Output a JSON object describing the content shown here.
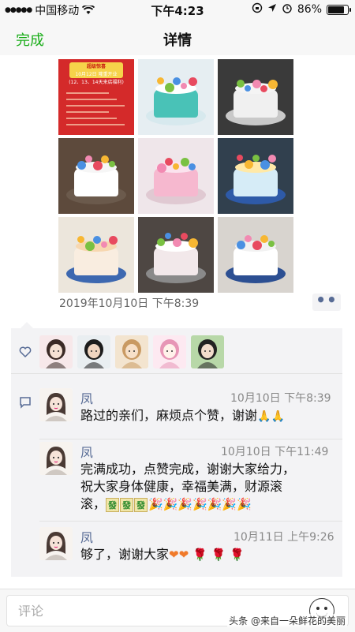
{
  "status_bar": {
    "carrier": "中国移动",
    "time": "下午4:23",
    "battery": "86%",
    "battery_level": 0.86
  },
  "nav": {
    "done_label": "完成",
    "title": "详情"
  },
  "photos": [
    {
      "name": "photo-poster",
      "kind": "poster",
      "poster_lines": [
        "超级惊喜",
        "10月12日 隆重开业",
        "(12、13、14天来店福利)"
      ]
    },
    {
      "name": "photo-cake-teal",
      "kind": "cake",
      "top": "#ffffff",
      "body": "#49c2b7",
      "plate": "#d7e9ee",
      "bg": "#e6eef2"
    },
    {
      "name": "photo-cake-stars",
      "kind": "cake",
      "top": "#f4f4f4",
      "body": "#f0f0f0",
      "plate": "#c9c9c9",
      "bg": "#3a3a3a"
    },
    {
      "name": "photo-cake-dolls",
      "kind": "cake",
      "top": "#f6f6f6",
      "body": "#ffffff",
      "plate": "#6b5a4c",
      "bg": "#5d4a3c"
    },
    {
      "name": "photo-cake-pink",
      "kind": "cake",
      "top": "#fbe3ee",
      "body": "#f6b8cf",
      "plate": "#e0c9d2",
      "bg": "#efe6ea"
    },
    {
      "name": "photo-cake-train",
      "kind": "cake",
      "top": "#ffe9a8",
      "body": "#d6ecf7",
      "plate": "#2e5aa8",
      "bg": "#31404e"
    },
    {
      "name": "photo-cake-bear",
      "kind": "cake",
      "top": "#f7d7b0",
      "body": "#f9ede0",
      "plate": "#3d68b0",
      "bg": "#ece6dc"
    },
    {
      "name": "photo-cake-wings",
      "kind": "cake",
      "top": "#ffffff",
      "body": "#f2e8ea",
      "plate": "#8a8a8a",
      "bg": "#4e4743"
    },
    {
      "name": "photo-cake-blue-train",
      "kind": "cake",
      "top": "#f2f2f2",
      "body": "#ffffff",
      "plate": "#2c4f92",
      "bg": "#d8d4cf"
    }
  ],
  "post": {
    "time": "2019年10月10日 下午8:39",
    "more_label": "••"
  },
  "likers": [
    {
      "name": "liker-1",
      "bg": "#f7e8ea",
      "face": "#f5e1d4",
      "hair": "#3b2a26"
    },
    {
      "name": "liker-2",
      "bg": "#e9eef1",
      "face": "#f0d5c0",
      "hair": "#1c1c1c"
    },
    {
      "name": "liker-3",
      "bg": "#f3e4cf",
      "face": "#f7e0c8",
      "hair": "#c99a63"
    },
    {
      "name": "liker-4",
      "bg": "#fde9f1",
      "face": "#fff2ea",
      "hair": "#e796b6"
    },
    {
      "name": "liker-5",
      "bg": "#b8d8a8",
      "face": "#f2dccc",
      "hair": "#222222"
    }
  ],
  "comments": [
    {
      "name": "凤",
      "time": "10月10日 下午8:39",
      "text": "路过的亲们，麻烦点个赞，谢谢",
      "emoji_1": "🙏🙏"
    },
    {
      "name": "凤",
      "time": "10月10日 下午11:49",
      "line_1": "完满成功，点赞完成，谢谢大家给力，",
      "line_2": "祝大家身体健康，幸福美满，财源滚",
      "line_3": "滚，",
      "fa_1": "發",
      "fa_2": "發",
      "fa_3": "發",
      "party": "🎉🎉🎉🎉🎉🎉🎉"
    },
    {
      "name": "凤",
      "time": "10月11日 上午9:26",
      "text": "够了，谢谢大家",
      "hearts": "❤❤",
      "roses": "🌹 🌹 🌹"
    }
  ],
  "comment_input": {
    "placeholder": "评论"
  },
  "watermark": "头条 @来自一朵鲜花的美丽",
  "colors": {
    "accent_green": "#1aad19",
    "link_blue": "#576b95",
    "panel_bg": "#f3f3f5"
  },
  "icons": [
    "wifi-icon",
    "signal-icon",
    "lock-rotation-icon",
    "location-icon",
    "alarm-icon",
    "battery-icon",
    "heart-icon",
    "comment-icon",
    "smiley-icon"
  ]
}
